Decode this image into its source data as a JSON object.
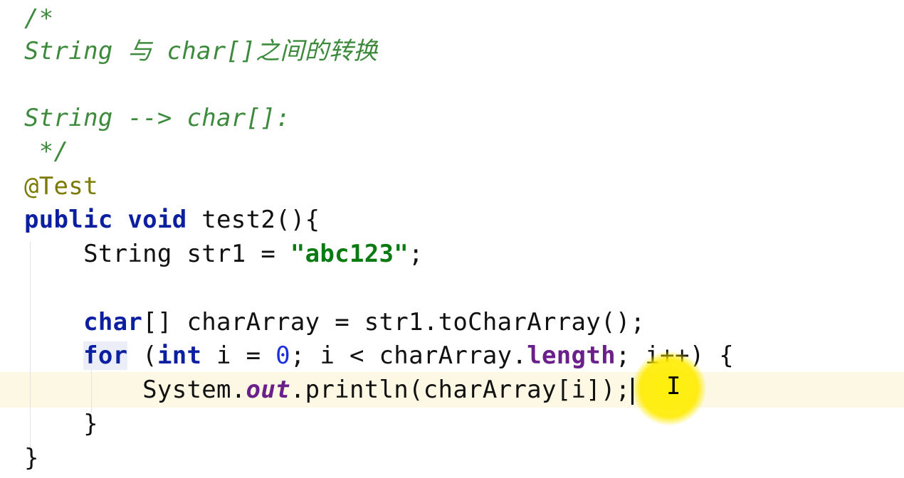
{
  "editor": {
    "comment_open": "/*",
    "comment_title": "String 与 char[]之间的转换",
    "comment_conversion": "String --> char[]:",
    "comment_close": " */",
    "annotation": "@Test",
    "method": {
      "kw_public": "public",
      "kw_void": "void",
      "signature": " test2(){"
    },
    "line_str": {
      "decl": "    String str1 = ",
      "literal": "\"abc123\"",
      "end": ";"
    },
    "line_char_array": {
      "kw_char": "char",
      "rest": "[] charArray = str1.toCharArray();"
    },
    "line_for": {
      "kw_for": "for",
      "open": " (",
      "kw_int": "int",
      "mid": " i = ",
      "zero": "0",
      "cond": "; i < charArray.",
      "field_length": "length",
      "tail": "; i++) {"
    },
    "line_println": {
      "system": "        System.",
      "out": "out",
      "call": ".println(charArray[i]);"
    },
    "close_inner": "    }",
    "close_outer": "}"
  },
  "colors": {
    "comment": "#3d8a3d",
    "keyword": "#0b1fa0",
    "string": "#0a7a12",
    "number": "#1b2ee0",
    "field": "#6a1f8a",
    "current_line": "#fcf8e4",
    "cursor_highlight": "#ffef00"
  },
  "cursor": {
    "icon": "i-beam-icon",
    "glyph": "I"
  }
}
